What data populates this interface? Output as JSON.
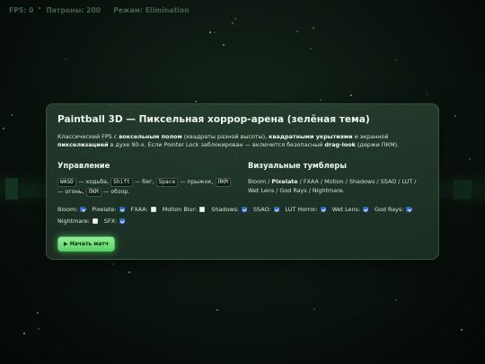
{
  "hud": {
    "fps": "FPS: 0",
    "ammo": "Патроны: 200",
    "mode": "Режим: Elimination"
  },
  "panel": {
    "title": "Paintball 3D — Пиксельная хоррор-арена (зелёная тема)",
    "intro": {
      "p1": "Классический FPS с ",
      "b1": "воксельным полом",
      "p2": " (квадраты разной высоты), ",
      "b2": "квадратными укрытиями",
      "p3": " и экранной ",
      "b3": "пикселизацией",
      "p4": " в духе 90-х. Если Pointer Lock заблокирован — включится безопасный ",
      "b4": "drag-look",
      "p5": " (держи ПКМ)."
    },
    "controls": {
      "heading": "Управление",
      "key_wasd": "WASD",
      "t_wasd": " — ходьба, ",
      "key_shift": "Shift",
      "t_shift": " — бег, ",
      "key_space": "Space",
      "t_space": " — прыжок, ",
      "key_lmb": "ЛКМ",
      "t_lmb": " — огонь, ",
      "key_rmb": "ПКМ",
      "t_rmb": " — обзор."
    },
    "visual": {
      "heading": "Визуальные тумблеры",
      "text_start": "Bloom / ",
      "text_bold": "Pixelate",
      "text_end": " / FXAA / Motion / Shadows / SSAO / LUT / Wet Lens / God Rays / Nightmare."
    },
    "toggles": [
      {
        "label": "Bloom:",
        "checked": true
      },
      {
        "label": "Pixelate:",
        "checked": true
      },
      {
        "label": "FXAA:",
        "checked": false
      },
      {
        "label": "Motion Blur:",
        "checked": false
      },
      {
        "label": "Shadows:",
        "checked": true
      },
      {
        "label": "SSAO:",
        "checked": true
      },
      {
        "label": "LUT Horror:",
        "checked": true
      },
      {
        "label": "Wet Lens:",
        "checked": true
      },
      {
        "label": "God Rays:",
        "checked": true
      },
      {
        "label": "Nightmare:",
        "checked": false
      },
      {
        "label": "SFX:",
        "checked": true
      }
    ],
    "start_button": "▶ Начать матч"
  }
}
